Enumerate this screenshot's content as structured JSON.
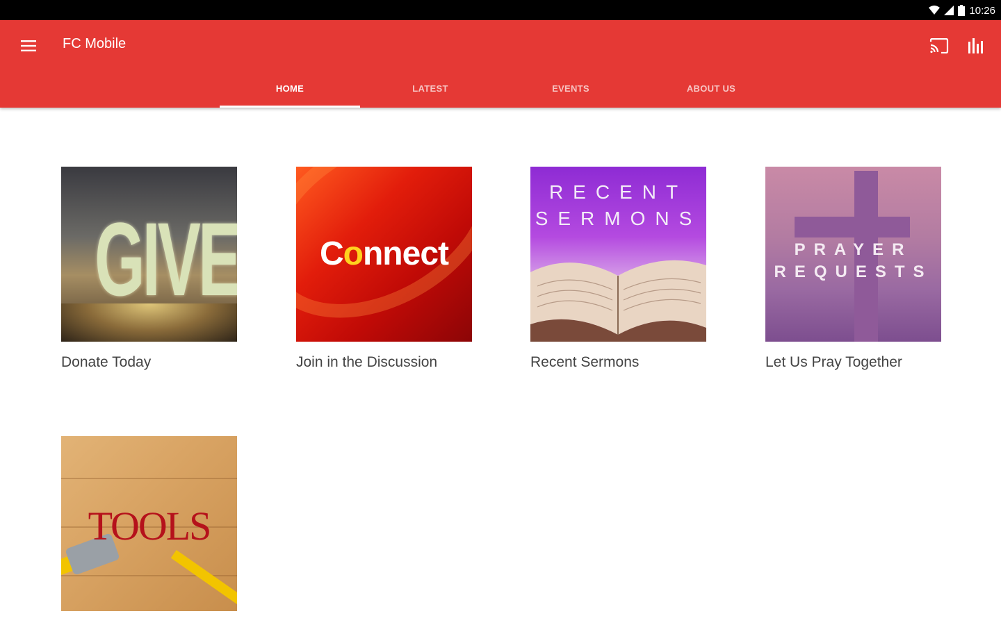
{
  "status_bar": {
    "time": "10:26"
  },
  "app": {
    "title": "FC Mobile"
  },
  "tabs": [
    {
      "label": "HOME",
      "active": true
    },
    {
      "label": "LATEST",
      "active": false
    },
    {
      "label": "EVENTS",
      "active": false
    },
    {
      "label": "ABOUT US",
      "active": false
    }
  ],
  "tiles": [
    {
      "caption": "Donate Today",
      "image_text": "GIVE"
    },
    {
      "caption": "Join in the Discussion",
      "image_text": "Connect"
    },
    {
      "caption": "Recent Sermons",
      "image_text": "RECENT SERMONS"
    },
    {
      "caption": "Let Us Pray Together",
      "image_text": "PRAYER REQUESTS"
    },
    {
      "caption": "",
      "image_text": "TOOLS"
    }
  ],
  "colors": {
    "app_bar": "#e53935",
    "status_bar": "#000000",
    "caption_text": "#444444"
  },
  "icons": {
    "menu": "menu-icon",
    "cast": "cast-icon",
    "stats": "bar-chart-icon",
    "wifi": "wifi-icon",
    "signal": "signal-icon",
    "battery": "battery-icon"
  }
}
